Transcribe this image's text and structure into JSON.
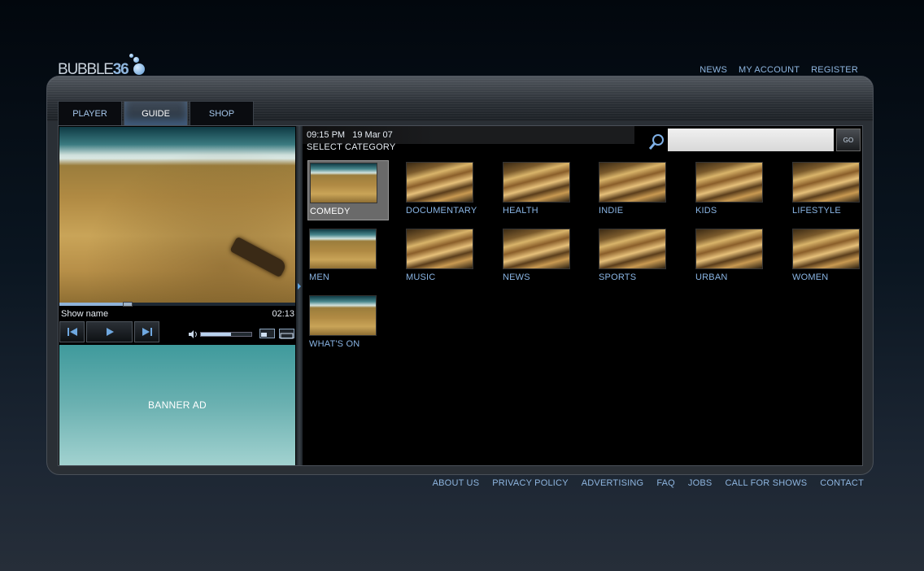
{
  "logo": {
    "text": "BUBBLE",
    "num": "36"
  },
  "top_nav": [
    "NEWS",
    "MY ACCOUNT",
    "REGISTER"
  ],
  "tabs": [
    {
      "label": "PLAYER",
      "active": false
    },
    {
      "label": "GUIDE",
      "active": true
    },
    {
      "label": "SHOP",
      "active": false
    }
  ],
  "player": {
    "show_name": "Show name",
    "time": "02:13",
    "progress": 0.29,
    "volume": 0.6
  },
  "banner": {
    "label": "BANNER AD"
  },
  "guide": {
    "time": "09:15 PM",
    "date": "19 Mar 07",
    "select_label": "SELECT CATEGORY",
    "search_placeholder": "",
    "go_label": "GO",
    "categories": [
      {
        "label": "COMEDY",
        "thumb": "beach",
        "selected": true
      },
      {
        "label": "DOCUMENTARY",
        "thumb": "desert",
        "selected": false
      },
      {
        "label": "HEALTH",
        "thumb": "desert",
        "selected": false
      },
      {
        "label": "INDIE",
        "thumb": "desert",
        "selected": false
      },
      {
        "label": "KIDS",
        "thumb": "desert",
        "selected": false
      },
      {
        "label": "LIFESTYLE",
        "thumb": "desert",
        "selected": false
      },
      {
        "label": "MEN",
        "thumb": "beach",
        "selected": false
      },
      {
        "label": "MUSIC",
        "thumb": "desert",
        "selected": false
      },
      {
        "label": "NEWS",
        "thumb": "desert",
        "selected": false
      },
      {
        "label": "SPORTS",
        "thumb": "desert",
        "selected": false
      },
      {
        "label": "URBAN",
        "thumb": "desert",
        "selected": false
      },
      {
        "label": "WOMEN",
        "thumb": "desert",
        "selected": false
      },
      {
        "label": "WHAT'S ON",
        "thumb": "beach",
        "selected": false
      }
    ]
  },
  "footer_nav": [
    "ABOUT US",
    "PRIVACY POLICY",
    "ADVERTISING",
    "FAQ",
    "JOBS",
    "CALL FOR SHOWS",
    "CONTACT"
  ],
  "colors": {
    "link": "#8ab5e4",
    "accent": "#5fa3e0",
    "banner": "#6bb1b1"
  }
}
